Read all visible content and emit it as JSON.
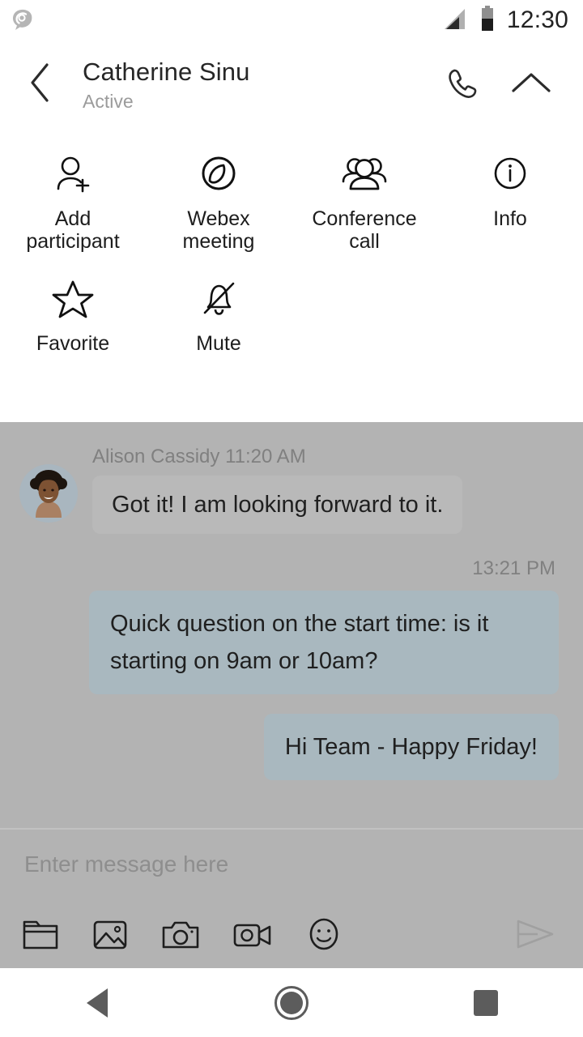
{
  "status_bar": {
    "app_icon": "webex-swirl-icon",
    "signal_icon": "cellular-signal-icon",
    "battery_icon": "battery-icon",
    "clock": "12:30"
  },
  "header": {
    "back_icon": "chevron-left-icon",
    "contact_name": "Catherine Sinu",
    "contact_status": "Active",
    "call_icon": "phone-icon",
    "collapse_icon": "chevron-up-icon"
  },
  "action_panel": {
    "actions": [
      {
        "icon": "add-participant-icon",
        "label": "Add\nparticipant",
        "line1": "Add",
        "line2": "participant"
      },
      {
        "icon": "webex-meeting-icon",
        "label": "Webex\nmeeting",
        "line1": "Webex",
        "line2": "meeting"
      },
      {
        "icon": "conference-call-icon",
        "label": "Conference\ncall",
        "line1": "Conference",
        "line2": "call"
      },
      {
        "icon": "info-icon",
        "label": "Info",
        "line1": "Info",
        "line2": ""
      },
      {
        "icon": "star-icon",
        "label": "Favorite",
        "line1": "Favorite",
        "line2": ""
      },
      {
        "icon": "bell-slash-icon",
        "label": "Mute",
        "line1": "Mute",
        "line2": ""
      }
    ]
  },
  "chat": {
    "messages": [
      {
        "direction": "incoming",
        "sender": "Alison Cassidy",
        "time": "11:20 AM",
        "meta": "Alison Cassidy  11:20 AM",
        "text": "Got it! I am looking forward to it.",
        "avatar": "contact-avatar"
      },
      {
        "direction": "outgoing",
        "time": "13:21 PM",
        "text": "Quick question on the start time: is it starting on 9am or 10am?"
      },
      {
        "direction": "outgoing",
        "time": "",
        "text": "Hi Team - Happy Friday!"
      }
    ]
  },
  "composer": {
    "placeholder": "Enter message here",
    "value": "",
    "icons": [
      {
        "name": "folder-icon"
      },
      {
        "name": "image-icon"
      },
      {
        "name": "camera-icon"
      },
      {
        "name": "video-icon"
      },
      {
        "name": "emoji-icon"
      }
    ],
    "send_icon": "send-icon"
  },
  "nav_bar": {
    "back": "back-triangle-icon",
    "home": "home-circle-icon",
    "recents": "recents-square-icon"
  },
  "colors": {
    "panel_bg": "#ffffff",
    "scrim": "#b3b3b3",
    "bubble_incoming": "#b9b9b9",
    "bubble_outgoing": "#a9b8bf",
    "text_primary": "#1f1f1f",
    "text_secondary": "#808080",
    "nav_icon": "#5c5c5c"
  }
}
